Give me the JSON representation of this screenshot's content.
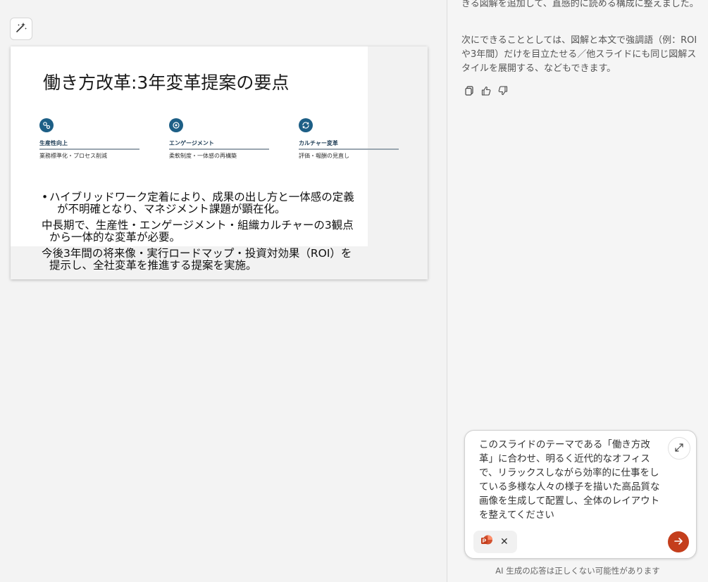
{
  "slide": {
    "title": "働き方改革:3年変革提案の要点",
    "pillars": [
      {
        "title": "生産性向上",
        "subtitle": "業務標準化・プロセス削減"
      },
      {
        "title": "エンゲージメント",
        "subtitle": "柔軟制度・一体感の再構築"
      },
      {
        "title": "カルチャー変革",
        "subtitle": "評価・報酬の見直し"
      }
    ],
    "bullets": [
      {
        "marker": "•",
        "line1": "ハイブリッドワーク定着により、成果の出し方と一体感の定義",
        "line2": "が不明確となり、マネジメント課題が顕在化。"
      },
      {
        "marker": "",
        "line1": "中長期で、生産性・エンゲージメント・組織カルチャーの3観点",
        "line2": "から一体的な変革が必要。"
      },
      {
        "marker": "",
        "line1": "今後3年間の将来像・実行ロードマップ・投資対効果（ROI）を",
        "line2": "提示し、全社変革を推進する提案を実施。"
      }
    ],
    "accent_color": "#1d5f86"
  },
  "chat": {
    "msg1": "きる図解を追加して、直感的に読める構成に整えました。",
    "msg2": "次にできることとしては、図解と本文で強調語（例：ROIや3年間）だけを目立たせる／他スライドにも同じ図解スタイルを展開する、などもできます。",
    "prompt_text": "このスライドのテーマである「働き方改革」に合わせ、明るく近代的なオフィスで、リラックスしながら効率的に仕事をしている多様な人々の様子を描いた高品質な画像を生成して配置し、全体のレイアウトを整えてください",
    "disclaimer": "AI 生成の応答は正しくない可能性があります",
    "send_color": "#c43e1c"
  }
}
